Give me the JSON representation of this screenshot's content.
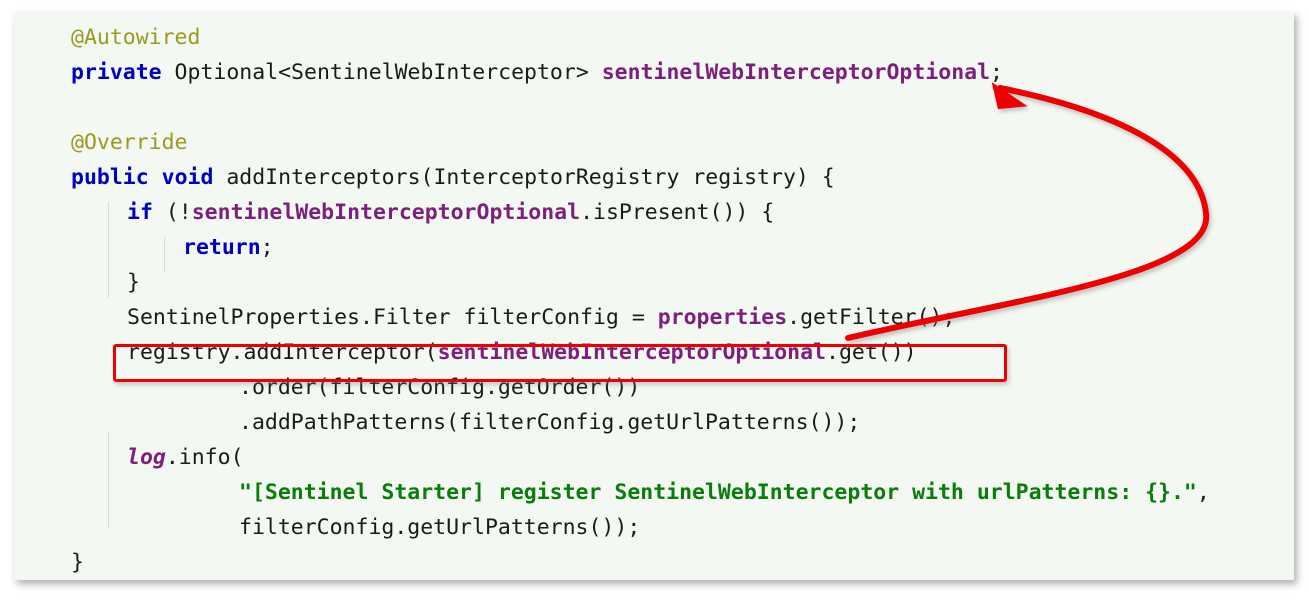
{
  "app": {
    "type": "code-snippet-screenshot",
    "panel_background": "#f4f8f2",
    "page_background": "#ffffff"
  },
  "theme": {
    "annotation_color": "#9a9a1c",
    "keyword_color": "#0000c0",
    "field_color": "#7d1f7d",
    "string_color": "#0a7c0a",
    "plain_text_color": "#1a1a1a",
    "highlight_color": "#ee0000",
    "indent_guide_color": "#d5dcd2"
  },
  "annotations": {
    "highlight_box_label": "registry.addInterceptor(sentinelWebInterceptorOptional.get())",
    "arrow_label": "arrow from highlighted registry.addInterceptor call to the sentinelWebInterceptorOptional field declaration",
    "arrow_color": "#ee0000"
  },
  "code": {
    "language": "java",
    "lines": [
      {
        "id": "line-1",
        "indent": 0,
        "tokens": [
          {
            "text": "@Autowired",
            "style": "anno"
          }
        ]
      },
      {
        "id": "line-2",
        "indent": 0,
        "tokens": [
          {
            "text": "private",
            "style": "kw"
          },
          {
            "text": " Optional<SentinelWebInterceptor> ",
            "style": "plain"
          },
          {
            "text": "sentinelWebInterceptorOptional",
            "style": "fld"
          },
          {
            "text": ";",
            "style": "plain"
          }
        ]
      },
      {
        "id": "line-3",
        "indent": 0,
        "tokens": [
          {
            "text": "",
            "style": "plain"
          }
        ]
      },
      {
        "id": "line-4",
        "indent": 0,
        "tokens": [
          {
            "text": "@Override",
            "style": "anno"
          }
        ]
      },
      {
        "id": "line-5",
        "indent": 0,
        "tokens": [
          {
            "text": "public",
            "style": "kw"
          },
          {
            "text": " ",
            "style": "plain"
          },
          {
            "text": "void",
            "style": "kw"
          },
          {
            "text": " addInterceptors(InterceptorRegistry registry) {",
            "style": "plain"
          }
        ]
      },
      {
        "id": "line-6",
        "indent": 1,
        "tokens": [
          {
            "text": "if",
            "style": "kw"
          },
          {
            "text": " (!",
            "style": "plain"
          },
          {
            "text": "sentinelWebInterceptorOptional",
            "style": "fld"
          },
          {
            "text": ".isPresent()) {",
            "style": "plain"
          }
        ]
      },
      {
        "id": "line-7",
        "indent": 2,
        "tokens": [
          {
            "text": "return",
            "style": "kw"
          },
          {
            "text": ";",
            "style": "plain"
          }
        ]
      },
      {
        "id": "line-8",
        "indent": 1,
        "tokens": [
          {
            "text": "}",
            "style": "plain"
          }
        ]
      },
      {
        "id": "line-9",
        "indent": 1,
        "tokens": [
          {
            "text": "SentinelProperties.Filter filterConfig = ",
            "style": "plain"
          },
          {
            "text": "properties",
            "style": "fld"
          },
          {
            "text": ".getFilter();",
            "style": "plain"
          }
        ]
      },
      {
        "id": "line-10",
        "indent": 1,
        "highlighted": true,
        "tokens": [
          {
            "text": "registry.addInterceptor(",
            "style": "plain"
          },
          {
            "text": "sentinelWebInterceptorOptional",
            "style": "fld"
          },
          {
            "text": ".get())",
            "style": "plain"
          }
        ]
      },
      {
        "id": "line-11",
        "indent": 3,
        "tokens": [
          {
            "text": ".order(filterConfig.getOrder())",
            "style": "plain"
          }
        ]
      },
      {
        "id": "line-12",
        "indent": 3,
        "tokens": [
          {
            "text": ".addPathPatterns(filterConfig.getUrlPatterns());",
            "style": "plain"
          }
        ]
      },
      {
        "id": "line-13",
        "indent": 1,
        "tokens": [
          {
            "text": "log",
            "style": "log"
          },
          {
            "text": ".info(",
            "style": "plain"
          }
        ]
      },
      {
        "id": "line-14",
        "indent": 3,
        "tokens": [
          {
            "text": "\"[Sentinel Starter] register SentinelWebInterceptor with urlPatterns: {}.\"",
            "style": "str"
          },
          {
            "text": ",",
            "style": "plain"
          }
        ]
      },
      {
        "id": "line-15",
        "indent": 3,
        "tokens": [
          {
            "text": "filterConfig.getUrlPatterns());",
            "style": "plain"
          }
        ]
      },
      {
        "id": "line-16",
        "indent": 0,
        "tokens": [
          {
            "text": "}",
            "style": "plain"
          }
        ]
      }
    ]
  }
}
